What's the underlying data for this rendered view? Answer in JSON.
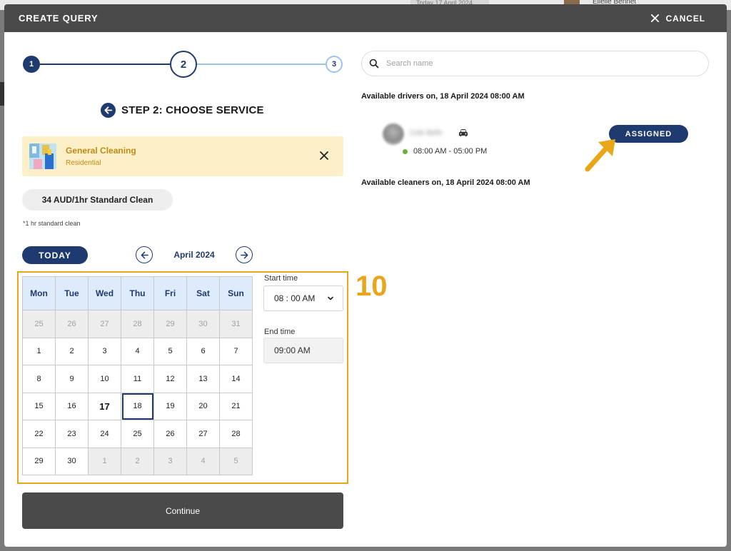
{
  "background": {
    "date_text": "Today 17 April 2024",
    "user_name": "Ellelle Bennet"
  },
  "header": {
    "title": "CREATE QUERY",
    "cancel_label": "CANCEL"
  },
  "stepper": {
    "steps": [
      "1",
      "2",
      "3"
    ],
    "current": 2
  },
  "step_title": "STEP 2: CHOOSE SERVICE",
  "service": {
    "name": "General Cleaning",
    "category": "Residential"
  },
  "price": {
    "label": "34 AUD/1hr Standard Clean",
    "note": "*1 hr standard clean"
  },
  "calendar": {
    "today_label": "TODAY",
    "month_label": "April 2024",
    "weekdays": [
      "Mon",
      "Tue",
      "Wed",
      "Thu",
      "Fri",
      "Sat",
      "Sun"
    ],
    "weeks": [
      [
        {
          "d": "25",
          "m": true
        },
        {
          "d": "26",
          "m": true
        },
        {
          "d": "27",
          "m": true
        },
        {
          "d": "28",
          "m": true
        },
        {
          "d": "29",
          "m": true
        },
        {
          "d": "30",
          "m": true
        },
        {
          "d": "31",
          "m": true
        }
      ],
      [
        {
          "d": "1"
        },
        {
          "d": "2"
        },
        {
          "d": "3"
        },
        {
          "d": "4"
        },
        {
          "d": "5"
        },
        {
          "d": "6"
        },
        {
          "d": "7"
        }
      ],
      [
        {
          "d": "8"
        },
        {
          "d": "9"
        },
        {
          "d": "10"
        },
        {
          "d": "11"
        },
        {
          "d": "12"
        },
        {
          "d": "13"
        },
        {
          "d": "14"
        }
      ],
      [
        {
          "d": "15"
        },
        {
          "d": "16"
        },
        {
          "d": "17",
          "today": true
        },
        {
          "d": "18",
          "selected": true
        },
        {
          "d": "19"
        },
        {
          "d": "20"
        },
        {
          "d": "21"
        }
      ],
      [
        {
          "d": "22"
        },
        {
          "d": "23"
        },
        {
          "d": "24"
        },
        {
          "d": "25"
        },
        {
          "d": "26"
        },
        {
          "d": "27"
        },
        {
          "d": "28"
        }
      ],
      [
        {
          "d": "29"
        },
        {
          "d": "30"
        },
        {
          "d": "1",
          "m": true
        },
        {
          "d": "2",
          "m": true
        },
        {
          "d": "3",
          "m": true
        },
        {
          "d": "4",
          "m": true
        },
        {
          "d": "5",
          "m": true
        }
      ]
    ]
  },
  "time": {
    "start_label": "Start time",
    "start_value": "08 : 00 AM",
    "end_label": "End time",
    "end_value": "09:00 AM"
  },
  "annotation_number": "10",
  "continue_label": "Continue",
  "search": {
    "placeholder": "Search name",
    "value": ""
  },
  "drivers": {
    "title": "Available drivers on, 18 April 2024 08:00 AM",
    "items": [
      {
        "name": "Cole Bello",
        "hours": "08:00 AM - 05:00 PM",
        "action_label": "ASSIGNED",
        "vehicle_icon": "car-icon"
      }
    ]
  },
  "cleaners": {
    "title": "Available cleaners on, 18 April 2024 08:00 AM"
  },
  "colors": {
    "primary": "#1f3a6e",
    "accent": "#e8a619",
    "header": "#4a4a4a",
    "service_bg": "#fdf0c8",
    "available": "#6fae3c"
  }
}
